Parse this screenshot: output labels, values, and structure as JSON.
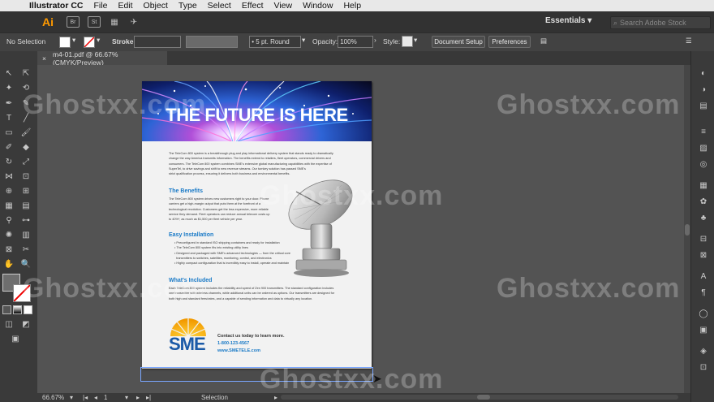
{
  "menubar": {
    "app_name": "Illustrator CC",
    "items": [
      "File",
      "Edit",
      "Object",
      "Type",
      "Select",
      "Effect",
      "View",
      "Window",
      "Help"
    ]
  },
  "appbar": {
    "logo": "Ai",
    "buttons": [
      "Br",
      "St"
    ],
    "workspace": "Essentials",
    "search_placeholder": "Search Adobe Stock"
  },
  "controlbar": {
    "selection": "No Selection",
    "stroke_label": "Stroke:",
    "brush": "5 pt. Round",
    "opacity_label": "Opacity:",
    "opacity_value": "100%",
    "style_label": "Style:",
    "document_setup": "Document Setup",
    "preferences": "Preferences"
  },
  "tab": {
    "title": "m4-01.pdf @ 66.67% (CMYK/Preview)",
    "close": "×"
  },
  "statusbar": {
    "zoom": "66.67%",
    "artboard": "1",
    "tool": "Selection"
  },
  "document": {
    "headline": "THE FUTURE IS HERE",
    "intro": [
      "The TeleCom 800 system is a breakthrough plug and play informational delivery system that stands ready to dramatically",
      "change the way America transmits information. The benefits extend to retailers, fleet operators, commercial drivers and",
      "consumers. The TeleCom 800 system combines SME's extensive global manufacturing capabilities with the expertise of",
      "SuperTel, to drive savings and shift to new revenue streams. Our turnkey solution has passed SME's",
      "strict qualification process, ensuring it delivers both business and environmental benefits."
    ],
    "benefits_title": "The Benefits",
    "benefits": [
      "The TeleCom 800 system drives new customers right to your door. Phone",
      "carriers get a high-margin output that puts them at the forefront of a",
      "technological revolution. Customers get the less expensive, more reliable",
      "service they demand. Fleet operators can reduce annual telecom costs up",
      "to 40%*, as much as $1,500 per fleet vehicle per year."
    ],
    "install_title": "Easy Installation",
    "install_bullets": [
      "Preconfigured in standard ISO shipping containers and ready for installation",
      "The TeleCom 800 system fits into existing utility lines",
      "Designed and packaged with SME's advanced technologies — from the critical core",
      "transmitters to switches, satellites, monitoring, control,  and electronics",
      "Highly compact configuration that is incredibly easy to install, operate and maintain"
    ],
    "included_title": "What's Included",
    "included": [
      "Each TeleCom 800 system includes the reliability and speed of Zen 900 transmitters. The standard configuration includes",
      "one transmitter with wireless channels, while additional units can be ordered as options. Our transmitters are designed for",
      "both high and standard fees/rates, and a capable of sending information and data to virtually any location."
    ],
    "logo_text": "SME",
    "contact_line": "Contact us today to learn more.",
    "phone": "1-800-123-4567",
    "website": "www.SMETELE.com"
  },
  "watermark": "Ghostxx.com"
}
